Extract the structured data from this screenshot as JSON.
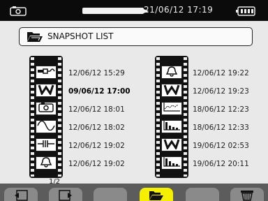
{
  "status_bar": {
    "datetime": "21/06/12 17:19",
    "progress_fraction": 0.6
  },
  "header": {
    "title": "SNAPSHOT LIST"
  },
  "left_column": [
    {
      "icon": "harmonics-probe-icon",
      "timestamp": "12/06/12 15:29",
      "selected": false
    },
    {
      "icon": "power-w-icon",
      "timestamp": "09/06/12 17:00",
      "selected": true
    },
    {
      "icon": "camera-icon",
      "timestamp": "12/06/12 18:01",
      "selected": false
    },
    {
      "icon": "waveform-icon",
      "timestamp": "12/06/12 18:02",
      "selected": false
    },
    {
      "icon": "transient-icon",
      "timestamp": "12/06/12 19:02",
      "selected": false
    },
    {
      "icon": "alarm-bell-icon",
      "timestamp": "12/06/12 19:02",
      "selected": false
    }
  ],
  "right_column": [
    {
      "icon": "alarm-bell-icon",
      "timestamp": "12/06/12 19:22",
      "selected": false
    },
    {
      "icon": "power-w-icon",
      "timestamp": "12/06/12 19:23",
      "selected": false
    },
    {
      "icon": "trend-graph-icon",
      "timestamp": "18/06/12 12:23",
      "selected": false
    },
    {
      "icon": "harmonic-bars-icon",
      "timestamp": "18/06/12 12:33",
      "selected": false
    },
    {
      "icon": "power-w-icon",
      "timestamp": "19/06/12 02:53",
      "selected": false
    },
    {
      "icon": "harmonic-bars-icon",
      "timestamp": "19/06/12 20:11",
      "selected": false
    }
  ],
  "pagination": {
    "label": "1/2"
  },
  "softkeys": [
    {
      "icon": "page-back-icon",
      "active": false
    },
    {
      "icon": "page-forward-icon",
      "active": false
    },
    {
      "icon": "blank",
      "active": false
    },
    {
      "icon": "folder-open-icon",
      "active": true
    },
    {
      "icon": "blank",
      "active": false
    },
    {
      "icon": "trash-icon",
      "active": false
    }
  ],
  "colors": {
    "screen_bg": "#e9e9e9",
    "status_bar_bg": "#0b0b0b",
    "softkey_bg": "#8a8a8a",
    "softkey_active": "#f5f000"
  }
}
